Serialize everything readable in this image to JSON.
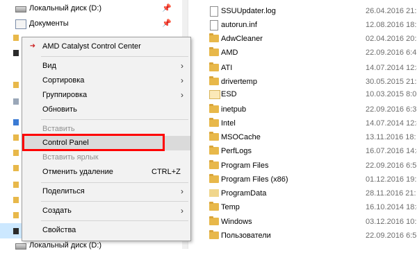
{
  "nav": {
    "local_disk_d": "Локальный диск (D:)",
    "documents": "Документы",
    "local_disk_d_bottom": "Локальный диск (D:)",
    "pin_icon": "pin-icon"
  },
  "files": [
    {
      "name": "SSUUpdater.log",
      "date": "26.04.2016 21:1",
      "icon": "file"
    },
    {
      "name": "autorun.inf",
      "date": "12.08.2016 18:1",
      "icon": "file"
    },
    {
      "name": "AdwCleaner",
      "date": "02.04.2016 20:5",
      "icon": "folder"
    },
    {
      "name": "AMD",
      "date": "22.09.2016 6:48",
      "icon": "folder"
    },
    {
      "name": "ATI",
      "date": "14.07.2014 12:4",
      "icon": "folder"
    },
    {
      "name": "drivertemp",
      "date": "30.05.2015 21:5",
      "icon": "folder"
    },
    {
      "name": "ESD",
      "date": "10.03.2015 8:06",
      "icon": "folder-light"
    },
    {
      "name": "inetpub",
      "date": "22.09.2016 6:37",
      "icon": "folder"
    },
    {
      "name": "Intel",
      "date": "14.07.2014 12:4",
      "icon": "folder"
    },
    {
      "name": "MSOCache",
      "date": "13.11.2016 18:",
      "icon": "folder"
    },
    {
      "name": "PerfLogs",
      "date": "16.07.2016 14:4",
      "icon": "folder"
    },
    {
      "name": "Program Files",
      "date": "22.09.2016 6:51",
      "icon": "folder"
    },
    {
      "name": "Program Files (x86)",
      "date": "01.12.2016 19:1",
      "icon": "folder"
    },
    {
      "name": "ProgramData",
      "date": "28.11.2016 21:",
      "icon": "folder-light"
    },
    {
      "name": "Temp",
      "date": "16.10.2014 18:4",
      "icon": "folder"
    },
    {
      "name": "Windows",
      "date": "03.12.2016 10:",
      "icon": "folder"
    },
    {
      "name": "Пользователи",
      "date": "22.09.2016 6:51",
      "icon": "folder"
    }
  ],
  "menu": {
    "amd": "AMD Catalyst Control Center",
    "view": "Вид",
    "sort": "Сортировка",
    "group": "Группировка",
    "refresh": "Обновить",
    "paste": "Вставить",
    "control_panel": "Control Panel",
    "paste_shortcut": "Вставить ярлык",
    "undo_delete": "Отменить удаление",
    "undo_shortcut": "CTRL+Z",
    "share": "Поделиться",
    "create": "Создать",
    "properties": "Свойства",
    "submenu_arrow": "›"
  },
  "colors": {
    "highlight_box": "#ff0000",
    "folder": "#e8b84a",
    "menu_bg": "#f2f2f2"
  }
}
